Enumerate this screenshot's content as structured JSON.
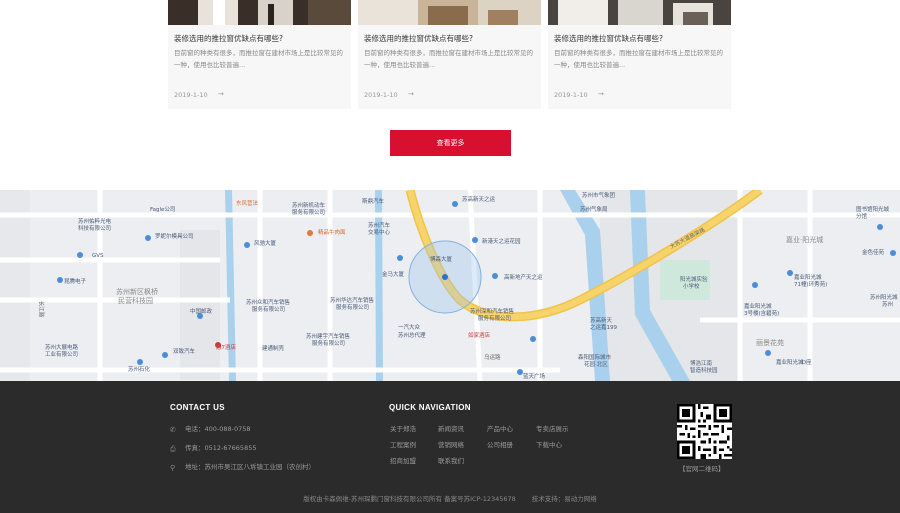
{
  "articles": [
    {
      "title": "装修选用的推拉窗优缺点有哪些?",
      "summary": "目前窗的种类有很多，而推拉窗在建材市场上是比较常见的一种，使用也比较普遍...",
      "date": "2019-1-10",
      "arrow": "→"
    },
    {
      "title": "装修选用的推拉窗优缺点有哪些?",
      "summary": "目前窗的种类有很多，而推拉窗在建材市场上是比较常见的一种，使用也比较普遍...",
      "date": "2019-1-10",
      "arrow": "→"
    },
    {
      "title": "装修选用的推拉窗优缺点有哪些?",
      "summary": "目前窗的种类有很多，而推拉窗在建材市场上是比较常见的一种，使用也比较普遍...",
      "date": "2019-1-10",
      "arrow": "→"
    }
  ],
  "more_button": "查看更多",
  "map": {
    "labels": [
      "东风营法",
      "Fagle公司",
      "苏州佑粹光电",
      "科技有限公司",
      "GVS",
      "罗妮尔模具公司",
      "昆腾电子",
      "苏州新区枫桥",
      "民营科技园",
      "中国邮政",
      "苏州大展电路",
      "工业有限公司",
      "苏州石化",
      "斯鼎汽车",
      "苏州新机动车",
      "服务有限公司",
      "苏州汽车",
      "交易中心",
      "精品牛肉面",
      "风驰大厦",
      "金马大厦",
      "苏州众和汽车销售",
      "服务有限公司",
      "苏州华达汽车销售",
      "服务有限公司",
      "博森大厦",
      "苏州建宇汽车销售",
      "服务有限公司",
      "一汽大众",
      "苏州总代理",
      "苏州深和汽车销售",
      "服务有限公司",
      "建通制壳",
      "通7酒店",
      "双致汽车",
      "如家酒店",
      "苏高新天之运",
      "新港天之运花园",
      "高新地产天之运",
      "苏州市气象团",
      "苏州气象局",
      "大苏大道高架路",
      "苏高新天",
      "之运嘉199",
      "阳光城实验",
      "小学校",
      "森阳国际城市",
      "花园·北区",
      "蓝天广场",
      "博浩江南",
      "智造科技园",
      "嘉业·阳光城",
      "嘉业阳光城",
      "71幢(环秀苑)",
      "嘉业阳光城",
      "3号楼(含碧苑)",
      "丽景花苑",
      "嘉业阳光城",
      "·D座",
      "图书馆阳光城",
      "分馆",
      "金色佳苑",
      "苏州阳光城",
      "苏州",
      "乌运路",
      "长江路"
    ]
  },
  "footer": {
    "contact_heading": "CONTACT US",
    "phone": "电话：400-088-0758",
    "fax": "传真：0512-67665855",
    "address": "地址：苏州市吴江区八坼镇工业园（农创村）",
    "nav_heading": "QUICK NAVIGATION",
    "nav_links": [
      "关于郑浩",
      "新闻资讯",
      "产品中心",
      "专卖店展示",
      "工程案例",
      "营销网络",
      "公司相册",
      "下载中心",
      "招商加盟",
      "联系我们"
    ],
    "qr_caption": "【官网二维码】",
    "copyright": "版权由卡森佩维-苏州琛鹏门窗科技有限公司所有 备案号苏ICP-12345678",
    "tech_support": "技术支持：易动力网络"
  }
}
